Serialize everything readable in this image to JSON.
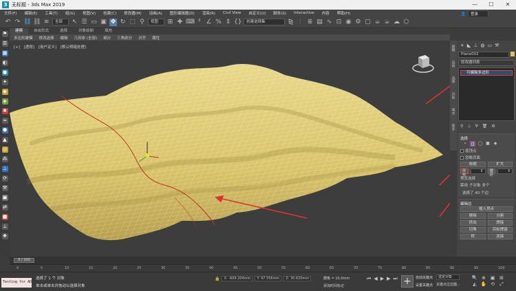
{
  "window": {
    "title": "无标题 - 3ds Max 2019",
    "controls": [
      "—",
      "☐",
      "✕"
    ]
  },
  "menu": [
    "文件(F)",
    "编辑(E)",
    "工具(T)",
    "组(G)",
    "视图(V)",
    "创建(C)",
    "修改器(M)",
    "动画(A)",
    "图形编辑器(D)",
    "渲染(R)",
    "Civil View",
    "自定义(U)",
    "脚本(S)",
    "Interactive",
    "内容",
    "帮助(H)"
  ],
  "user": {
    "label": "登录",
    "workspace": "工作区: 默认"
  },
  "toolbar": {
    "filter": "全部",
    "view": "视图",
    "selection_set": "创建选择集"
  },
  "tabs": [
    {
      "label": "建模",
      "active": true
    },
    {
      "label": "自由形式",
      "active": false
    },
    {
      "label": "选择",
      "active": false
    },
    {
      "label": "对象绘制",
      "active": false
    },
    {
      "label": "填充",
      "active": false
    }
  ],
  "ribbon": [
    "多边形建模",
    "修改选择",
    "编辑",
    "几何体 (全部)",
    "细分",
    "三角剖分",
    "对齐",
    "属性"
  ],
  "viewport": {
    "label": [
      "[+]",
      "[透视]",
      "[用户定义]",
      "[默认明暗处理]"
    ]
  },
  "command_panel": {
    "object_name": "Plane002",
    "object_color": "#e0c060",
    "modifier_list": "修改器列表",
    "stack_item": "可编辑多边形",
    "rollout_select": "选择",
    "by_vertex": "按顶点",
    "ignore_backfacing": "忽略背面",
    "grow": "收缩",
    "shrink": "扩大",
    "ring": "环形",
    "loop": "循环",
    "preview_selection": "预览选择",
    "preview_off": "禁用",
    "preview_sub": "子对象",
    "preview_multi": "多个",
    "selected_count": "选择了 40 个边",
    "rollout_edit": "编辑边",
    "insert_vertex": "插入顶点",
    "remove": "移除",
    "split": "分割",
    "extrude": "挤出",
    "weld": "焊接",
    "chamfer": "切角",
    "target_weld": "目标焊接",
    "bridge": "桥",
    "connect": "连接"
  },
  "vertical_tabs": [
    "建模",
    "自由",
    "选择",
    "对象",
    "填充",
    "更多"
  ],
  "timeline": {
    "slider": "0 / 100"
  },
  "ruler_ticks": [
    "0",
    "5",
    "10",
    "15",
    "20",
    "25",
    "30",
    "35",
    "40",
    "45",
    "50",
    "55",
    "60",
    "65",
    "70",
    "75",
    "80",
    "85",
    "90",
    "95",
    "100"
  ],
  "status": {
    "script": "Testing for AD",
    "line1": "选择了 1 个 对象",
    "line2": "单击或单击并拖动以选择对象",
    "x": "X: -609.204mm",
    "y": "Y: 97.556mm",
    "z": "Z: 30.620mm",
    "grid": "栅格 = 10.0mm",
    "add_time": "添加时间标记",
    "auto_key": "自动关键点",
    "set_key": "设置关键点",
    "selected_set": "选定对象",
    "key_filter": "关键点过滤器..."
  }
}
